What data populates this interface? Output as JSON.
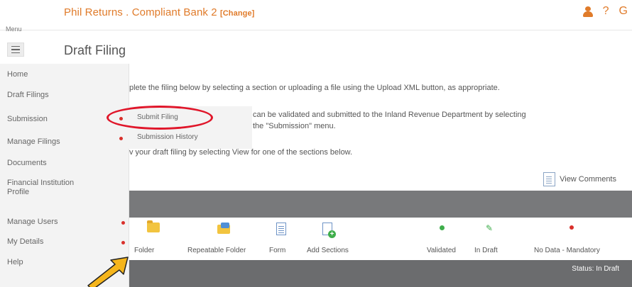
{
  "header": {
    "title": "Phil Returns . Compliant Bank 2",
    "change_label": "[Change]",
    "help_label": "?",
    "settings_label": "G"
  },
  "menu": {
    "label": "Menu"
  },
  "page": {
    "title": "Draft Filing"
  },
  "sidebar": {
    "items": [
      {
        "label": "Home"
      },
      {
        "label": "Draft Filings"
      },
      {
        "label": "Submission"
      },
      {
        "label": "Manage Filings"
      },
      {
        "label": "Documents"
      },
      {
        "label": "Financial Institution",
        "label2": "Profile"
      },
      {
        "label": "Manage Users"
      },
      {
        "label": "My Details"
      },
      {
        "label": "Help"
      }
    ]
  },
  "submenu": {
    "items": [
      {
        "label": "Submit Filing"
      },
      {
        "label": "Submission History"
      }
    ]
  },
  "content": {
    "line1": "plete the filing below by selecting a section or uploading a file using the Upload XML button, as appropriate.",
    "line2": "can be validated and submitted to the Inland Revenue Department by selecting",
    "line3": "the \"Submission\" menu.",
    "line4": "v your draft filing by selecting View for one of the sections below.",
    "view_comments": "View Comments"
  },
  "legend": {
    "items": [
      {
        "label": "Folder",
        "icon": "folder-icon"
      },
      {
        "label": "Repeatable Folder",
        "icon": "repeatable-folder-icon"
      },
      {
        "label": "Form",
        "icon": "form-icon"
      },
      {
        "label": "Add Sections",
        "icon": "add-section-icon"
      },
      {
        "label": "Validated",
        "icon": "validated-dot-icon"
      },
      {
        "label": "In Draft",
        "icon": "pencil-icon"
      },
      {
        "label": "No Data - Mandatory",
        "icon": "mandatory-dot-icon"
      }
    ]
  },
  "table": {
    "status_header": "Status: In Draft"
  },
  "colors": {
    "accent": "#e07b2a",
    "highlight": "#e0162a",
    "arrow": "#f5b51b",
    "bar": "#78797b"
  }
}
